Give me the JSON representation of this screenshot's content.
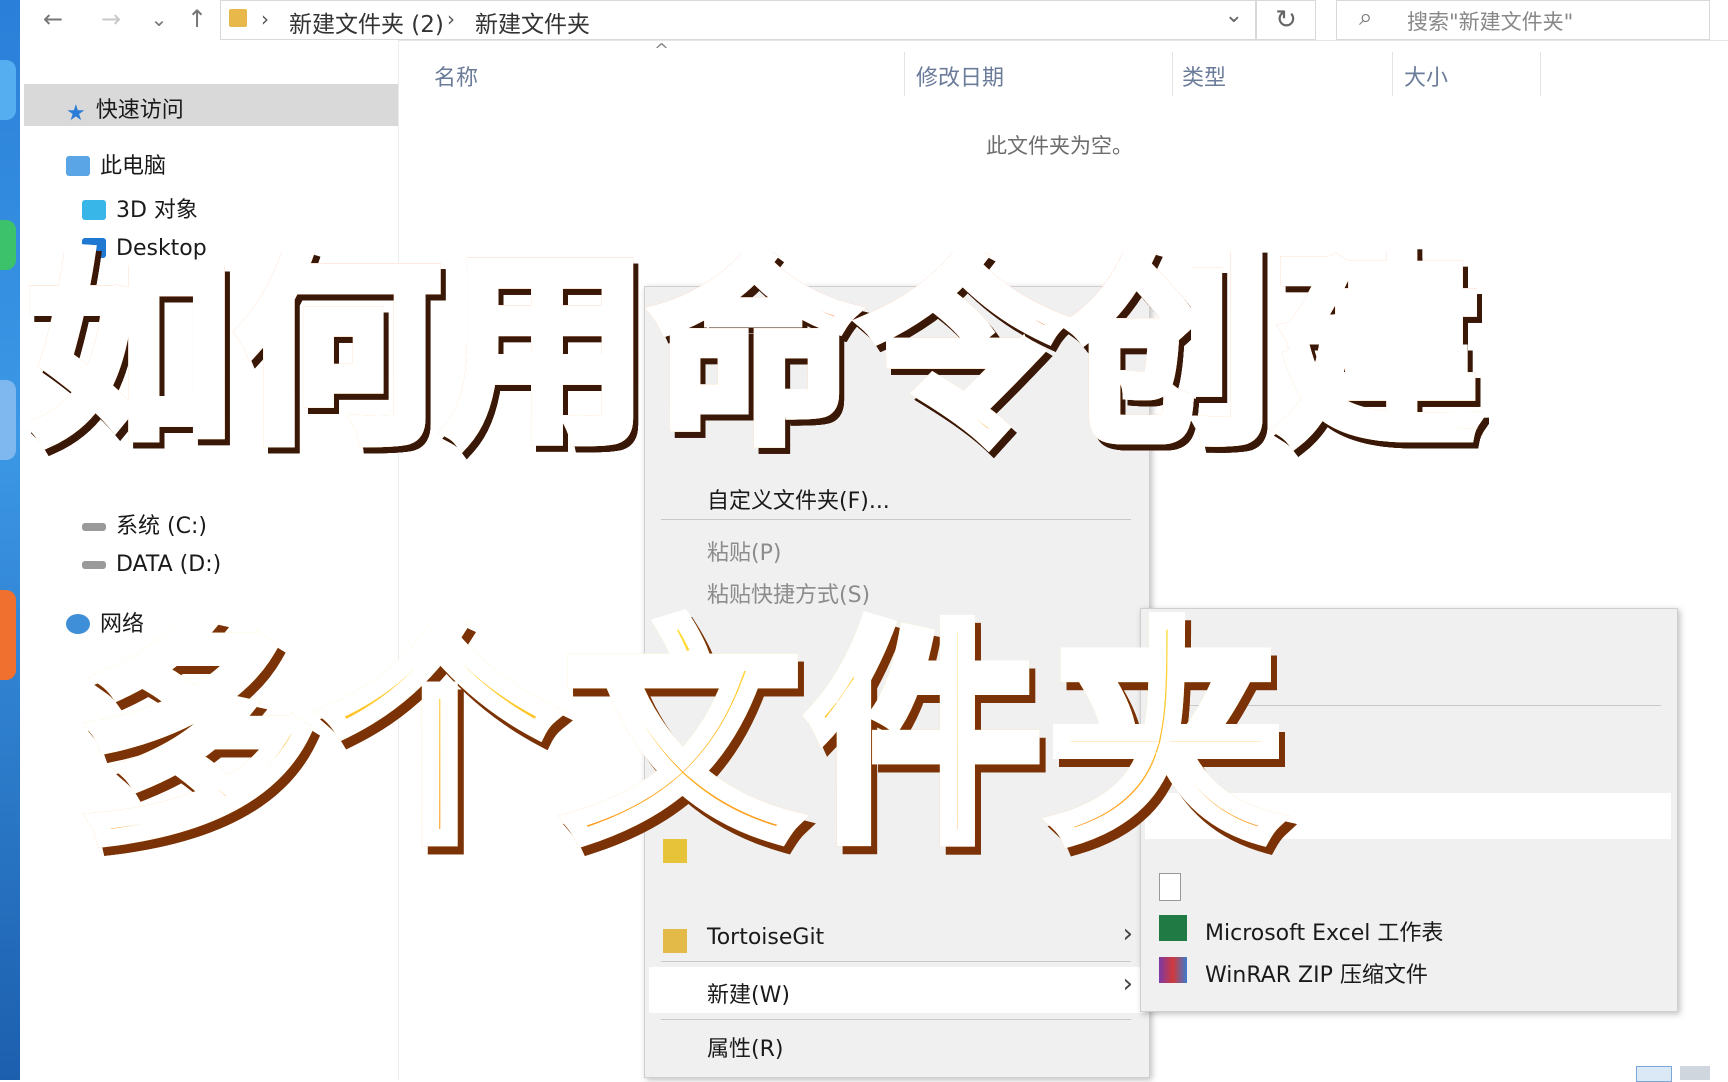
{
  "window": {
    "nav_buttons": {
      "back": "←",
      "forward": "→",
      "recent": "⌄",
      "up": "↑"
    },
    "breadcrumb": [
      "新建文件夹 (2)",
      "新建文件夹"
    ],
    "search_placeholder": "搜索\"新建文件夹\"",
    "refresh_icon": "↻",
    "dropdown_icon": "⌄"
  },
  "nav_pane": {
    "quick_access": "快速访问",
    "this_pc": "此电脑",
    "objects3d": "3D 对象",
    "desktop": "Desktop",
    "drive_c": "系统 (C:)",
    "drive_d": "DATA (D:)",
    "network": "网络"
  },
  "columns": {
    "name": "名称",
    "modified": "修改日期",
    "type": "类型",
    "size": "大小"
  },
  "empty_message": "此文件夹为空。",
  "context_menu": {
    "customize": "自定义文件夹(F)...",
    "paste": "粘贴(P)",
    "paste_shortcut": "粘贴快捷方式(S)",
    "tortoisegit": "TortoiseGit",
    "new": "新建(W)",
    "properties": "属性(R)"
  },
  "submenu": {
    "excel": "Microsoft Excel 工作表",
    "winrar": "WinRAR ZIP 压缩文件"
  },
  "overlay": {
    "line1": "如何用命令创建",
    "line2": "多个文件夹"
  },
  "colors": {
    "title1_top": "#ff5a0a",
    "title1_bottom": "#ffc13a",
    "title2_top": "#ffe23e",
    "title2_bottom": "#ff8f1a",
    "menu_bg": "#f0f0f0",
    "quick_access_highlight": "#d9d9d9"
  }
}
